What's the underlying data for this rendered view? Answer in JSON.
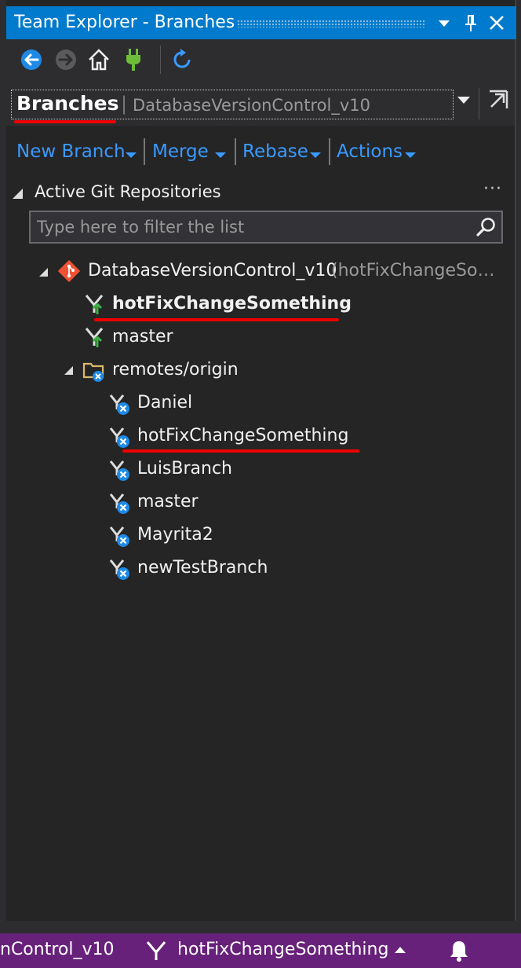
{
  "window": {
    "title": "Team Explorer - Branches"
  },
  "navigation": {
    "page": "Branches",
    "repository": "DatabaseVersionControl_v10"
  },
  "actions": [
    {
      "label": "New Branch"
    },
    {
      "label": "Merge"
    },
    {
      "label": "Rebase"
    },
    {
      "label": "Actions"
    }
  ],
  "section": {
    "title": "Active Git Repositories",
    "more": "···",
    "filter_placeholder": "Type here to filter the list"
  },
  "repo": {
    "name": "DatabaseVersionControl_v10",
    "current_branch_hint": "(hotFixChangeSo…",
    "local_branches": [
      {
        "name": "hotFixChangeSomething",
        "current": true
      },
      {
        "name": "master",
        "current": false
      }
    ],
    "remote": {
      "name": "remotes/origin",
      "branches": [
        "Daniel",
        "hotFixChangeSomething",
        "LuisBranch",
        "master",
        "Mayrita2",
        "newTestBranch"
      ]
    }
  },
  "statusbar": {
    "repo": "nControl_v10",
    "branch": "hotFixChangeSomething"
  },
  "colors": {
    "accent": "#007acc",
    "link": "#3a9aff",
    "statusbar": "#68217a",
    "git_icon": "#f05133",
    "annotation": "#e00000"
  }
}
